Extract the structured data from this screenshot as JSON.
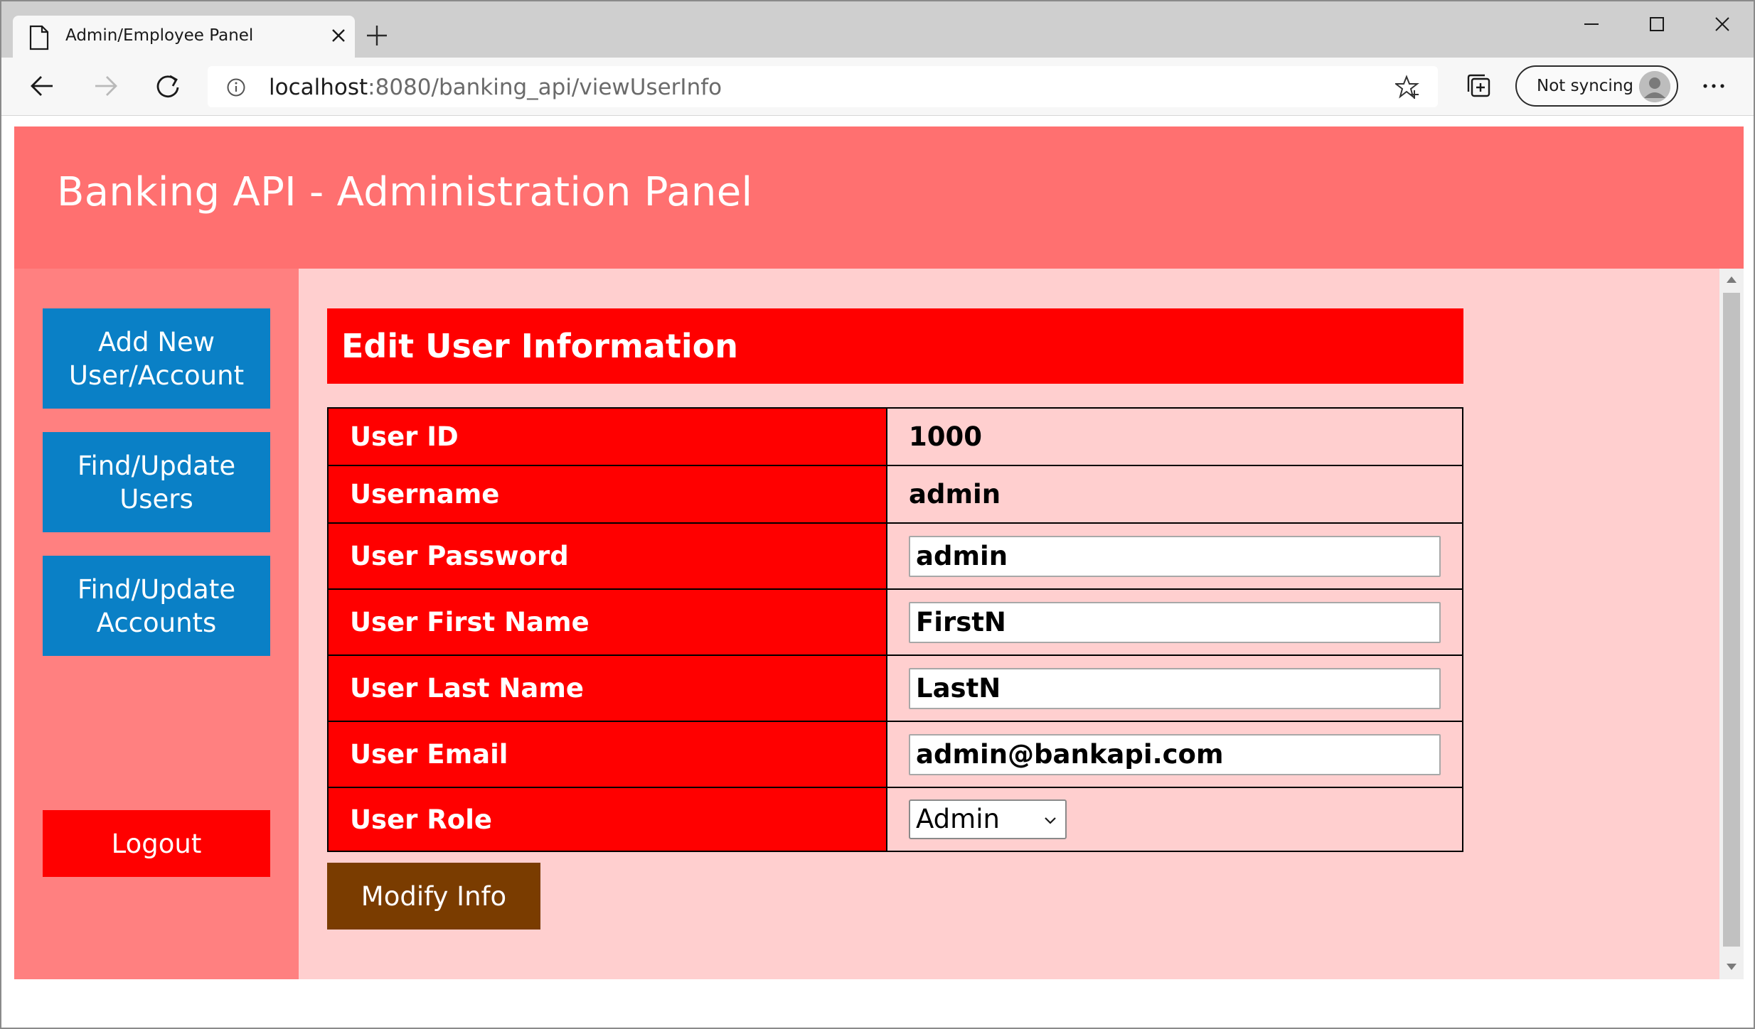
{
  "browser": {
    "tab_title": "Admin/Employee Panel",
    "url_host": "localhost",
    "url_path": ":8080/banking_api/viewUserInfo",
    "profile_label": "Not syncing"
  },
  "page": {
    "banner_title": "Banking API - Administration Panel"
  },
  "sidebar": {
    "items": [
      {
        "label": "Add New User/Account"
      },
      {
        "label": "Find/Update Users"
      },
      {
        "label": "Find/Update Accounts"
      }
    ],
    "logout_label": "Logout"
  },
  "form": {
    "title": "Edit User Information",
    "rows": [
      {
        "label": "User ID",
        "value": "1000"
      },
      {
        "label": "Username",
        "value": "admin"
      },
      {
        "label": "User Password",
        "value": "admin"
      },
      {
        "label": "User First Name",
        "value": "FirstN"
      },
      {
        "label": "User Last Name",
        "value": "LastN"
      },
      {
        "label": "User Email",
        "value": "admin@bankapi.com"
      },
      {
        "label": "User Role",
        "value": "Admin"
      }
    ],
    "submit_label": "Modify Info"
  },
  "colors": {
    "banner": "#ff7070",
    "sidebar": "#ff8080",
    "sidebar_button": "#0a80c6",
    "header_red": "#ff0000",
    "main_bg": "#ffcfcf",
    "submit_button": "#7a3c00"
  },
  "icons": [
    "page-icon",
    "close-icon",
    "plus-icon",
    "minimize-icon",
    "maximize-icon",
    "back-icon",
    "forward-icon",
    "refresh-icon",
    "info-icon",
    "star-icon",
    "collections-icon",
    "avatar-icon",
    "more-icon",
    "chevron-down-icon"
  ]
}
